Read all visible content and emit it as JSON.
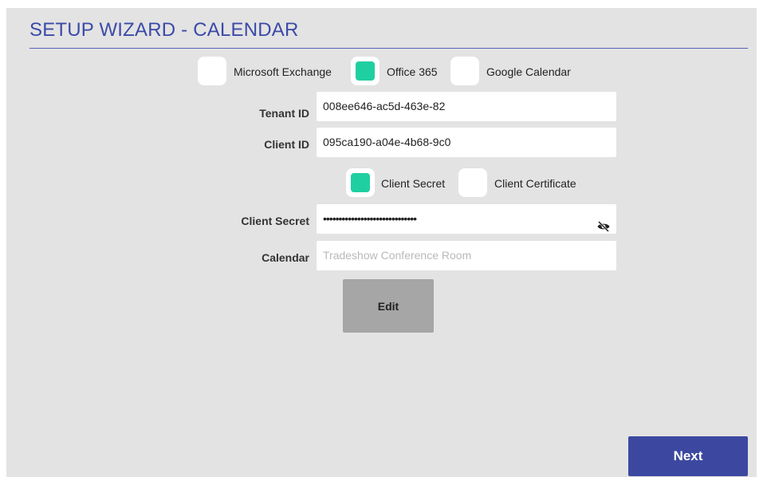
{
  "header": {
    "title": "SETUP WIZARD - CALENDAR"
  },
  "calendar_type": {
    "options": [
      {
        "label": "Microsoft Exchange",
        "checked": false
      },
      {
        "label": "Office 365",
        "checked": true
      },
      {
        "label": "Google Calendar",
        "checked": false
      }
    ]
  },
  "form": {
    "tenant_id": {
      "label": "Tenant ID",
      "value": "008ee646-ac5d-463e-82"
    },
    "client_id": {
      "label": "Client ID",
      "value": "095ca190-a04e-4b68-9c0"
    },
    "auth_method": {
      "options": [
        {
          "label": "Client Secret",
          "checked": true
        },
        {
          "label": "Client Certificate",
          "checked": false
        }
      ]
    },
    "client_secret": {
      "label": "Client Secret",
      "value": "••••••••••••••••••••••••••••••",
      "visibility_icon": "eye-off-icon"
    },
    "calendar": {
      "label": "Calendar",
      "placeholder": "Tradeshow Conference Room",
      "value": ""
    }
  },
  "buttons": {
    "edit": "Edit",
    "next": "Next"
  },
  "colors": {
    "accent": "#3b4aa8",
    "checked": "#1fcfa2",
    "background": "#e3e3e3",
    "next_button": "#3c48a0",
    "edit_button": "#a6a6a6"
  }
}
